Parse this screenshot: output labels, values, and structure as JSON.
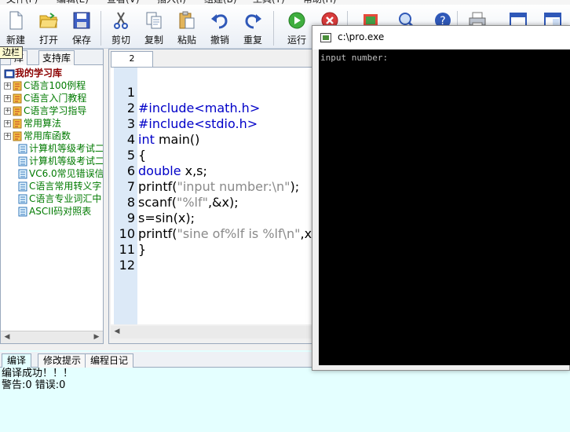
{
  "menubar": {
    "items": [
      "文件(F)",
      "编辑(E)",
      "查看(V)",
      "插入(I)",
      "组建(B)",
      "工具(T)",
      "帮助(H)"
    ]
  },
  "toolbar": {
    "buttons": [
      {
        "label": "新建",
        "icon": "new-file-icon"
      },
      {
        "label": "打开",
        "icon": "open-folder-icon"
      },
      {
        "label": "保存",
        "icon": "save-icon"
      },
      {
        "label": "剪切",
        "icon": "cut-icon"
      },
      {
        "label": "复制",
        "icon": "copy-icon"
      },
      {
        "label": "粘贴",
        "icon": "paste-icon"
      },
      {
        "label": "撤销",
        "icon": "undo-icon"
      },
      {
        "label": "重复",
        "icon": "redo-icon"
      },
      {
        "label": "运行",
        "icon": "run-icon"
      },
      {
        "label": "",
        "icon": "stop-icon"
      },
      {
        "label": "",
        "icon": "settings-icon"
      },
      {
        "label": "",
        "icon": "search-icon"
      },
      {
        "label": "",
        "icon": "help-icon"
      },
      {
        "label": "",
        "icon": "print-icon"
      },
      {
        "label": "",
        "icon": "window-icon"
      },
      {
        "label": "",
        "icon": "window2-icon"
      }
    ]
  },
  "sidebar": {
    "tooltip": "边栏",
    "tabs": [
      "库",
      "支持库"
    ],
    "tree": [
      {
        "label": "我的学习库",
        "type": "root"
      },
      {
        "label": "C语言100例程",
        "type": "book"
      },
      {
        "label": "C语言入门教程",
        "type": "book"
      },
      {
        "label": "C语言学习指导",
        "type": "book"
      },
      {
        "label": "常用算法",
        "type": "book"
      },
      {
        "label": "常用库函数",
        "type": "book"
      },
      {
        "label": "计算机等级考试二",
        "type": "doc"
      },
      {
        "label": "计算机等级考试二",
        "type": "doc"
      },
      {
        "label": "VC6.0常见错误信",
        "type": "doc"
      },
      {
        "label": "C语言常用转义字",
        "type": "doc"
      },
      {
        "label": "C语言专业词汇中",
        "type": "doc"
      },
      {
        "label": "ASCII码对照表",
        "type": "doc"
      }
    ]
  },
  "editor": {
    "tab_label": "2",
    "line_numbers": [
      "1",
      "2",
      "3",
      "4",
      "5",
      "6",
      "7",
      "8",
      "9",
      "10",
      "11",
      "12"
    ],
    "lines": [
      {
        "parts": []
      },
      {
        "parts": [
          {
            "t": "#include<math.h>",
            "c": "kw"
          }
        ]
      },
      {
        "parts": [
          {
            "t": "#include<stdio.h>",
            "c": "kw"
          }
        ]
      },
      {
        "parts": [
          {
            "t": "int",
            "c": "kw"
          },
          {
            "t": " main()",
            "c": ""
          }
        ]
      },
      {
        "parts": [
          {
            "t": "{",
            "c": ""
          }
        ]
      },
      {
        "parts": [
          {
            "t": "double",
            "c": "kw"
          },
          {
            "t": " x,s;",
            "c": ""
          }
        ]
      },
      {
        "parts": [
          {
            "t": "printf(",
            "c": ""
          },
          {
            "t": "\"input number:\\n\"",
            "c": "str"
          },
          {
            "t": ");",
            "c": ""
          }
        ]
      },
      {
        "parts": [
          {
            "t": "scanf(",
            "c": ""
          },
          {
            "t": "\"%lf\"",
            "c": "str"
          },
          {
            "t": ",&x);",
            "c": ""
          }
        ]
      },
      {
        "parts": [
          {
            "t": "s=sin(x);",
            "c": ""
          }
        ]
      },
      {
        "parts": [
          {
            "t": "printf(",
            "c": ""
          },
          {
            "t": "\"sine of%lf is %lf\\n\"",
            "c": "str"
          },
          {
            "t": ",x,s);",
            "c": ""
          }
        ]
      },
      {
        "parts": [
          {
            "t": "}",
            "c": ""
          }
        ]
      },
      {
        "parts": []
      }
    ]
  },
  "bottom": {
    "tabs": [
      "编译",
      "修改提示",
      "编程日记"
    ],
    "active_tab": 0,
    "lines": [
      "编译成功！！！",
      "警告:0    错误:0"
    ]
  },
  "console": {
    "title": "c:\\pro.exe",
    "output": "input number:"
  }
}
